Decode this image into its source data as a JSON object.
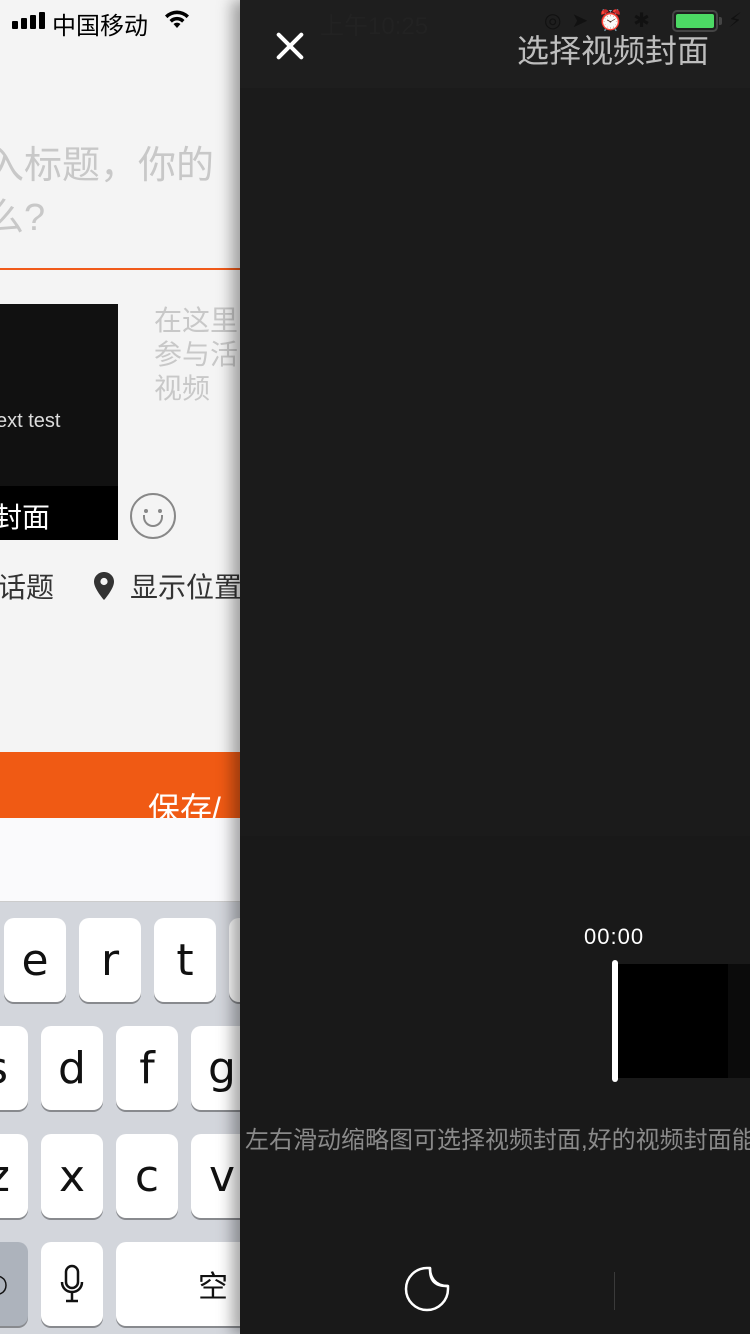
{
  "status_bar": {
    "carrier": "中国移动",
    "time": "上午10:25",
    "battery_level": 1.0
  },
  "editor": {
    "title_placeholder": "入标题，你的\n么?",
    "thumbnail_text": "ext test",
    "thumbnail_label": "封面",
    "description_lines": [
      "在这里",
      "参与活",
      "视频"
    ],
    "topic_label": "话题",
    "location_label": "显示位置",
    "save_button": "保存/_",
    "emoji_icon": "smiley-icon",
    "location_icon": "location-pin-icon"
  },
  "keyboard": {
    "row1": [
      "e",
      "r",
      "t"
    ],
    "row2": [
      "s",
      "d",
      "f",
      "g"
    ],
    "row3": [
      "z",
      "x",
      "c",
      "v"
    ],
    "row4_space": "空"
  },
  "cover_panel": {
    "title": "选择视频封面",
    "close_icon": "close-icon",
    "timestamp": "00:00",
    "hint": "左右滑动缩略图可选择视频封面,好的视频封面能",
    "sticker_icon": "sticker-icon"
  },
  "colors": {
    "accent": "#f05a14",
    "panel_bg": "#191919",
    "battery": "#4cd964"
  }
}
